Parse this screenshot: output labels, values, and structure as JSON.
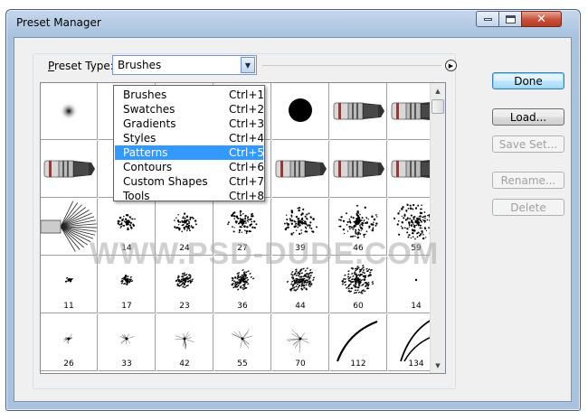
{
  "window": {
    "title": "Preset Manager",
    "close_glyph": "✕"
  },
  "preset": {
    "label_prefix": "P",
    "label_rest": "reset Type:",
    "value": "Brushes"
  },
  "menu": [
    {
      "label": "Brushes",
      "shortcut": "Ctrl+1",
      "selected": false
    },
    {
      "label": "Swatches",
      "shortcut": "Ctrl+2",
      "selected": false
    },
    {
      "label": "Gradients",
      "shortcut": "Ctrl+3",
      "selected": false
    },
    {
      "label": "Styles",
      "shortcut": "Ctrl+4",
      "selected": false
    },
    {
      "label": "Patterns",
      "shortcut": "Ctrl+5",
      "selected": true
    },
    {
      "label": "Contours",
      "shortcut": "Ctrl+6",
      "selected": false
    },
    {
      "label": "Custom Shapes",
      "shortcut": "Ctrl+7",
      "selected": false
    },
    {
      "label": "Tools",
      "shortcut": "Ctrl+8",
      "selected": false
    }
  ],
  "buttons": {
    "done": "Done",
    "load": "Load...",
    "save": "Save Set...",
    "rename": "Rename...",
    "delete": "Delete"
  },
  "brushes": [
    [
      "",
      "",
      "",
      "",
      "",
      "",
      ""
    ],
    [
      "",
      "",
      "",
      "",
      "",
      "",
      ""
    ],
    [
      "",
      "14",
      "24",
      "27",
      "39",
      "46",
      "59"
    ],
    [
      "11",
      "17",
      "23",
      "36",
      "44",
      "60",
      "14"
    ],
    [
      "26",
      "33",
      "42",
      "55",
      "70",
      "112",
      "134"
    ]
  ],
  "watermark": "WWW.PSD-DUDE.COM"
}
